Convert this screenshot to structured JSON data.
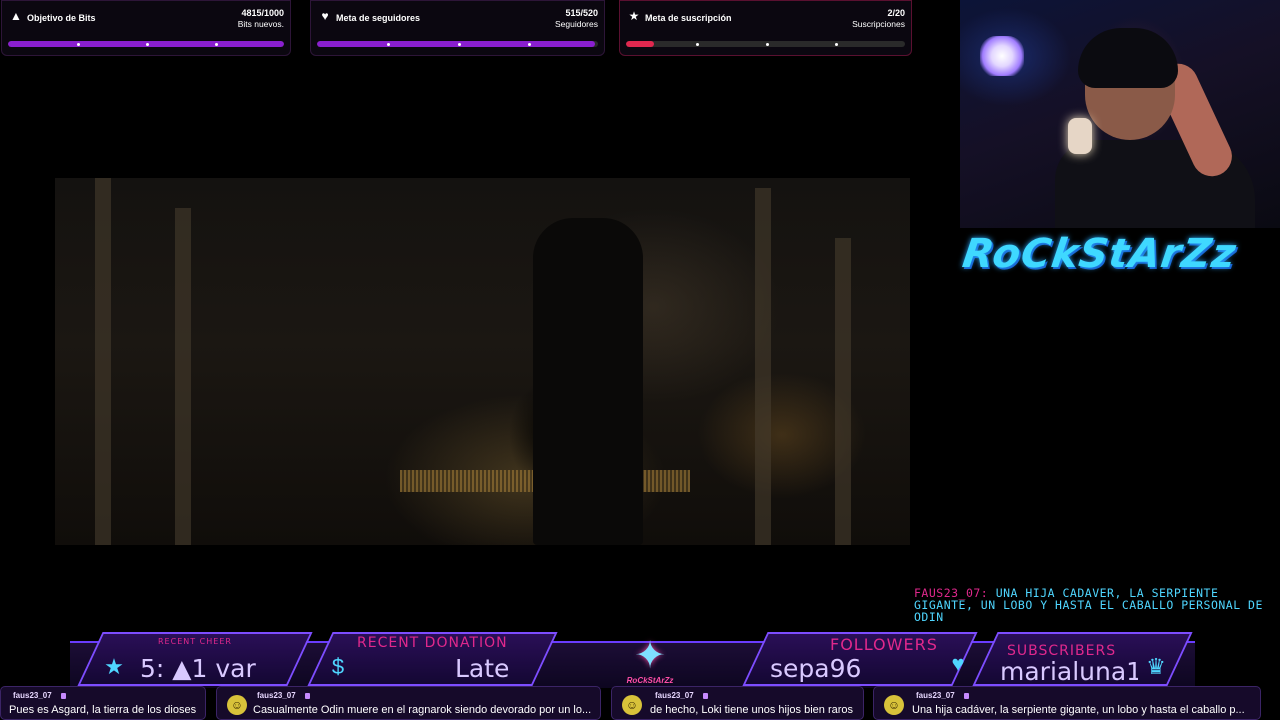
{
  "goals": [
    {
      "icon": "bits-icon",
      "title": "Objetivo de Bits",
      "value": "4815/1000",
      "sub": "Bits nuevos.",
      "progress": 1.0,
      "color": "#8a1fcf"
    },
    {
      "icon": "heart-icon",
      "title": "Meta de seguidores",
      "value": "515/520",
      "sub": "Seguidores",
      "progress": 0.99,
      "color": "#8a1fcf"
    },
    {
      "icon": "star-icon",
      "title": "Meta de suscripción",
      "value": "2/20",
      "sub": "Suscripciones",
      "progress": 0.1,
      "color": "#e0284f"
    }
  ],
  "channel": {
    "logo_text": "RoCkStArZz"
  },
  "chat_overlay": {
    "user": "FAUS23_07:",
    "text": "UNA HIJA CADAVER, LA SERPIENTE GIGANTE, UN LOBO Y HASTA EL CABALLO PERSONAL DE ODIN"
  },
  "bottom_bar": {
    "recent_cheer": {
      "label": "RECENT CHEER",
      "value": "5: ▲1 var"
    },
    "recent_donation": {
      "label": "RECENT DONATION",
      "value": "Late"
    },
    "center_logo": {
      "text": "RoCkStArZz"
    },
    "followers": {
      "label": "FOLLOWERS",
      "value": "sepa96"
    },
    "subscribers": {
      "label": "SUBSCRIBERS",
      "value": "marialuna1"
    }
  },
  "chat_cards": [
    {
      "user": "faus23_07",
      "text": "Pues es Asgard, la tierra de los dioses",
      "has_avatar": false
    },
    {
      "user": "faus23_07",
      "text": "Casualmente Odin muere en el ragnarok siendo devorado por un lo...",
      "has_avatar": true
    },
    {
      "user": "faus23_07",
      "text": "de hecho, Loki tiene unos hijos bien raros",
      "has_avatar": true
    },
    {
      "user": "faus23_07",
      "text": "Una hija cadáver, la serpiente gigante, un lobo y hasta el caballo p...",
      "has_avatar": true
    }
  ],
  "colors": {
    "accent": "#7d4dff",
    "cyan": "#4fd6ff",
    "pink": "#e0288c"
  }
}
